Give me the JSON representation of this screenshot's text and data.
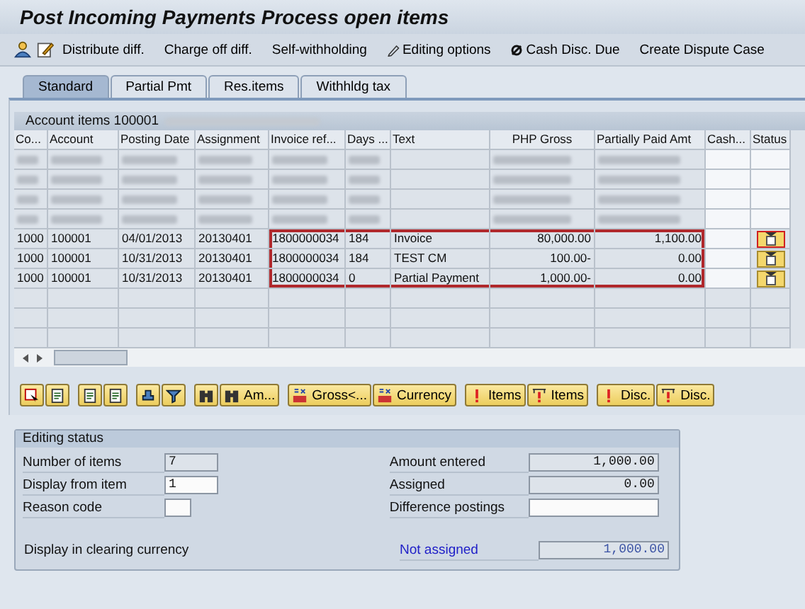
{
  "window": {
    "title": "Post Incoming Payments Process open items"
  },
  "toolbar": [
    {
      "kind": "icon"
    },
    {
      "kind": "icon"
    },
    {
      "kind": "text",
      "label": "Distribute diff."
    },
    {
      "kind": "text",
      "label": "Charge off diff."
    },
    {
      "kind": "text",
      "label": "Self-withholding"
    },
    {
      "kind": "text",
      "label": "Editing options"
    },
    {
      "kind": "text",
      "label": "Cash Disc. Due"
    },
    {
      "kind": "text",
      "label": "Create Dispute Case"
    }
  ],
  "tabs": [
    {
      "label": "Standard",
      "selected": true
    },
    {
      "label": "Partial Pmt",
      "selected": false
    },
    {
      "label": "Res.items",
      "selected": false
    },
    {
      "label": "Withhldg tax",
      "selected": false
    }
  ],
  "table": {
    "caption": "Account items 100001",
    "caption_redacted": true,
    "columns": [
      "Co...",
      "Account",
      "Posting Date",
      "Assignment",
      "Invoice ref...",
      "Days ...",
      "Text",
      "PHP Gross",
      "Partially Paid Amt",
      "Cash...",
      "Status"
    ],
    "rows": [
      {
        "kind": "redacted"
      },
      {
        "kind": "redacted"
      },
      {
        "kind": "redacted"
      },
      {
        "kind": "redacted"
      },
      {
        "kind": "item",
        "highlighted": true,
        "status_selected": true,
        "cells": [
          "1000",
          "100001",
          "04/01/2013",
          "20130401",
          "1800000034",
          "184",
          "Invoice",
          "80,000.00",
          "1,100.00"
        ]
      },
      {
        "kind": "item",
        "highlighted": true,
        "status_selected": false,
        "cells": [
          "1000",
          "100001",
          "10/31/2013",
          "20130401",
          "1800000034",
          "184",
          "TEST CM",
          "100.00-",
          "0.00"
        ]
      },
      {
        "kind": "item",
        "highlighted": true,
        "status_selected": false,
        "cells": [
          "1000",
          "100001",
          "10/31/2013",
          "20130401",
          "1800000034",
          "0",
          "Partial Payment",
          "1,000.00-",
          "0.00"
        ]
      },
      {
        "kind": "empty"
      },
      {
        "kind": "empty"
      },
      {
        "kind": "empty"
      }
    ]
  },
  "buttons": [
    {
      "kind": "icon"
    },
    {
      "kind": "icon"
    },
    {
      "kind": "icon"
    },
    {
      "kind": "icon"
    },
    {
      "kind": "icon"
    },
    {
      "kind": "icon"
    },
    {
      "kind": "icon"
    },
    {
      "kind": "labeled",
      "label": "Am..."
    },
    {
      "kind": "labeled",
      "label": "Gross<..."
    },
    {
      "kind": "labeled",
      "label": "Currency"
    },
    {
      "kind": "labeled",
      "label": "Items"
    },
    {
      "kind": "labeled",
      "label": "Items"
    },
    {
      "kind": "labeled",
      "label": "Disc."
    },
    {
      "kind": "labeled",
      "label": "Disc."
    }
  ],
  "editing_status": {
    "title": "Editing status",
    "left": [
      {
        "label": "Number of items",
        "value": "7",
        "editable": false
      },
      {
        "label": "Display from item",
        "value": "1",
        "editable": true
      },
      {
        "label": "Reason code",
        "editable": true
      }
    ],
    "right": [
      {
        "label": "Amount entered",
        "value": "1,000.00",
        "editable": false
      },
      {
        "label": "Assigned",
        "value": "0.00",
        "editable": false
      },
      {
        "label": "Difference postings",
        "editable": true
      }
    ],
    "bottom_left": "Display in clearing currency",
    "bottom_right": {
      "label": "Not assigned",
      "value": "1,000.00"
    }
  }
}
